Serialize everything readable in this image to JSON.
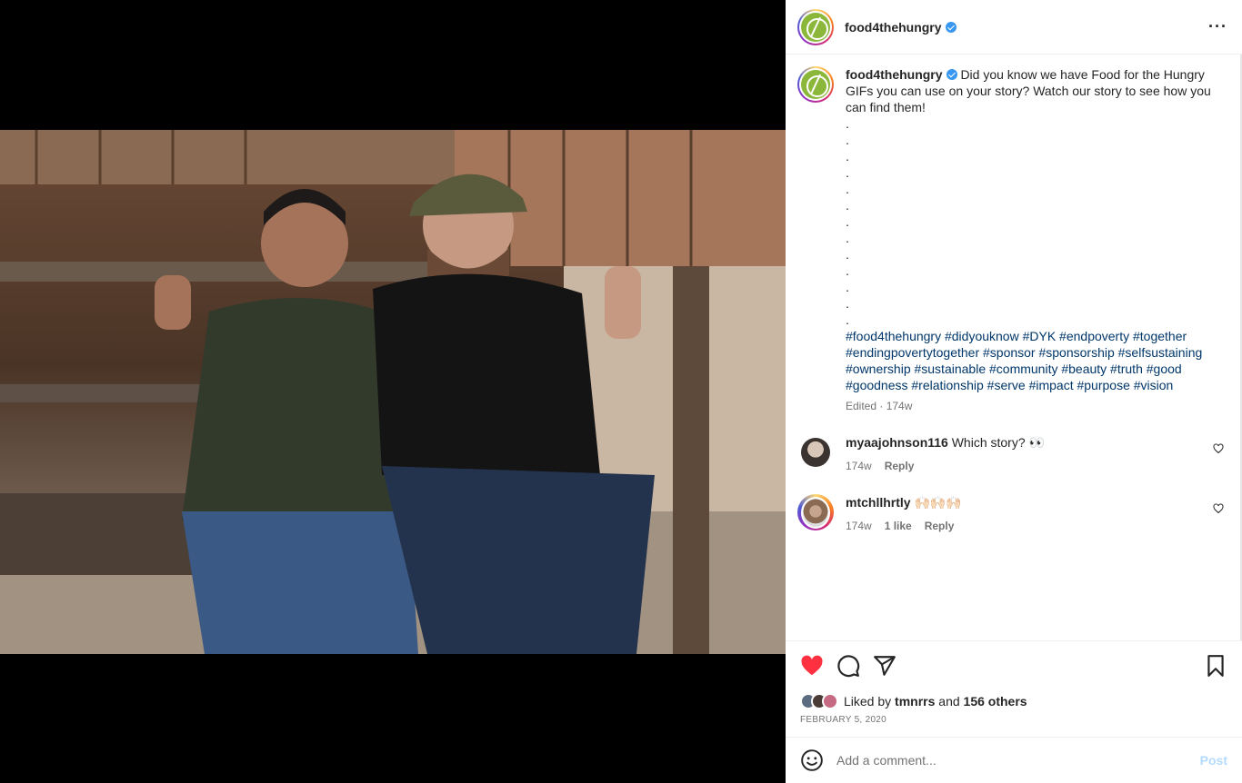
{
  "post": {
    "author": "food4thehungry",
    "caption_text": "Did you know we have Food for the Hungry GIFs you can use on your story? Watch our story to see how you can find them!",
    "dots": [
      ".",
      ".",
      ".",
      ".",
      ".",
      ".",
      ".",
      ".",
      ".",
      ".",
      ".",
      ".",
      "."
    ],
    "hashtags": "#food4thehungry #didyouknow #DYK #endpoverty #together #endingpovertytogether #sponsor #sponsorship #selfsustaining #ownership #sustainable #community #beauty #truth #good #goodness #relationship #serve #impact #purpose #vision",
    "meta": "Edited · 174w"
  },
  "comments": [
    {
      "user": "myaajohnson116",
      "text": "Which story? 👀",
      "time": "174w",
      "likes": "",
      "reply": "Reply"
    },
    {
      "user": "mtchllhrtly",
      "text": "🙌🏻🙌🏻🙌🏻",
      "time": "174w",
      "likes": "1 like",
      "reply": "Reply"
    }
  ],
  "likes": {
    "prefix": "Liked by",
    "user": "tmnrrs",
    "middle": "and",
    "others": "156 others"
  },
  "date": "FEBRUARY 5, 2020",
  "add_comment": {
    "placeholder": "Add a comment...",
    "post_label": "Post"
  },
  "icons": {
    "like": "heart-filled-icon",
    "comment": "comment-icon",
    "share": "share-icon",
    "save": "bookmark-icon",
    "more": "more-icon",
    "emoji": "emoji-icon",
    "verified": "verified-icon"
  },
  "colors": {
    "like_red": "#ff3040",
    "hashtag_blue": "#00376b",
    "post_disabled": "#b3dbff",
    "verified_blue": "#3897f0",
    "logo_green": "#8bb73a"
  }
}
